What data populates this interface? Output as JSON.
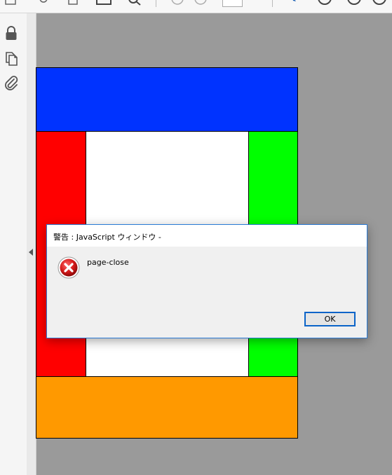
{
  "toolbar": {
    "icons": [
      "save-icon",
      "upload-icon",
      "print-icon",
      "email-icon",
      "search-icon",
      "prev-page-icon",
      "next-page-icon",
      "page-number-field",
      "select-tool-icon",
      "zoom-out-icon",
      "zoom-in-icon"
    ]
  },
  "sidebar": {
    "icons": [
      "lock-icon",
      "pages-icon",
      "attachment-icon"
    ]
  },
  "document": {
    "colors": {
      "top": "#0033ff",
      "left": "#ff0000",
      "center": "#ffffff",
      "right": "#00ff00",
      "bottom": "#ff9900"
    }
  },
  "dialog": {
    "title": "警告 : JavaScript ウィンドウ -",
    "message": "page-close",
    "ok_label": "OK",
    "icon": "error-icon"
  }
}
